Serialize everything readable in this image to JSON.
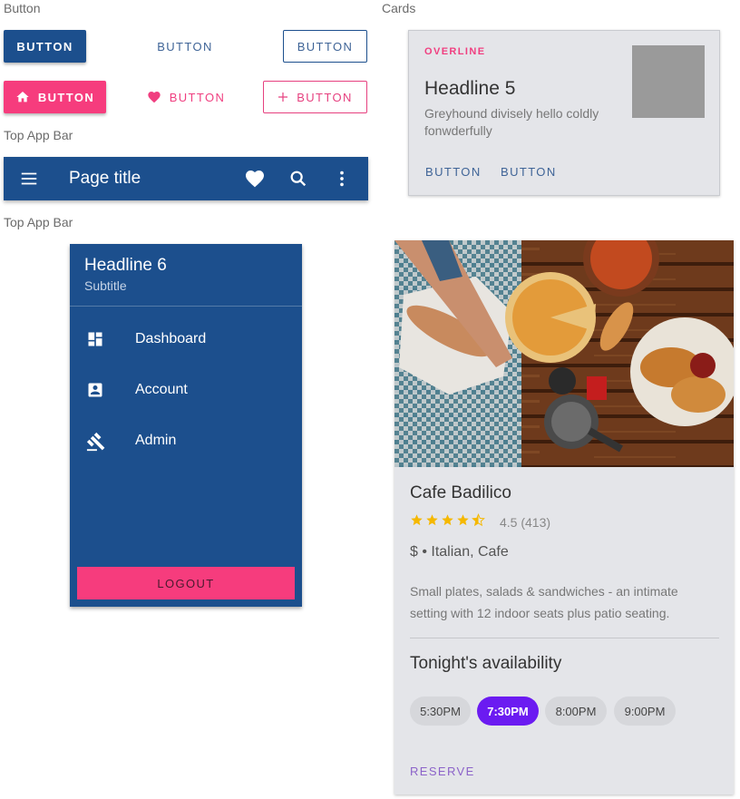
{
  "sections": {
    "button_label": "Button",
    "cards_label": "Cards",
    "top_app_bar_label_1": "Top App Bar",
    "top_app_bar_label_2": "Top App Bar"
  },
  "buttons": {
    "row1": [
      "BUTTON",
      "BUTTON",
      "BUTTON"
    ],
    "row2": [
      "BUTTON",
      "BUTTON",
      "BUTTON"
    ],
    "icons": [
      "home-icon",
      "heart-icon",
      "plus-icon"
    ]
  },
  "appbar": {
    "title": "Page title",
    "icons": [
      "menu-icon",
      "heart-icon",
      "search-icon",
      "more-vert-icon"
    ]
  },
  "drawer": {
    "headline": "Headline 6",
    "subtitle": "Subtitle",
    "items": [
      {
        "label": "Dashboard",
        "icon": "dashboard-icon"
      },
      {
        "label": "Account",
        "icon": "account-box-icon"
      },
      {
        "label": "Admin",
        "icon": "gavel-icon"
      }
    ],
    "logout": "LOGOUT"
  },
  "card1": {
    "overline": "OVERLINE",
    "headline": "Headline 5",
    "body": "Greyhound divisely hello coldly fonwderfully",
    "actions": [
      "BUTTON",
      "BUTTON"
    ]
  },
  "card2": {
    "name": "Cafe Badilico",
    "rating": 4.5,
    "rating_text": "4.5 (413)",
    "price_category": "$ • Italian, Cafe",
    "description": "Small plates, salads & sandwiches - an intimate setting with 12 indoor seats plus patio seating.",
    "availability_title": "Tonight's availability",
    "times": [
      "5:30PM",
      "7:30PM",
      "8:00PM",
      "9:00PM"
    ],
    "selected_time": "7:30PM",
    "reserve": "RESERVE"
  },
  "colors": {
    "primary": "#1c4f8d",
    "secondary": "#f63c7d",
    "chip_selected": "#6b1bf1",
    "star": "#f5b800"
  }
}
